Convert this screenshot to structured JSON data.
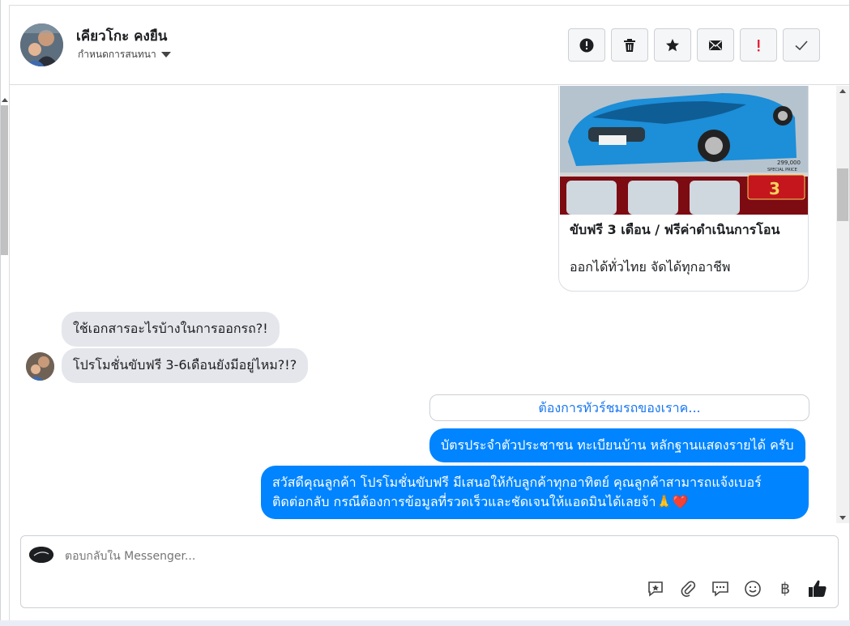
{
  "header": {
    "contact_name": "เคียวโกะ คงยืน",
    "assign_label": "กำหนดการสนทนา",
    "actions": [
      {
        "name": "spam-button",
        "icon": "alert-circle-icon"
      },
      {
        "name": "delete-button",
        "icon": "trash-icon"
      },
      {
        "name": "star-button",
        "icon": "star-icon"
      },
      {
        "name": "mark-unread-button",
        "icon": "envelope-icon"
      },
      {
        "name": "follow-up-button",
        "icon": "exclamation-icon"
      },
      {
        "name": "done-button",
        "icon": "check-icon"
      }
    ]
  },
  "card": {
    "image_caption_price": "299,000",
    "image_caption_tag": "SPECIAL PRICE",
    "image_badge_number": "3",
    "title": "ขับฟรี 3 เดือน / ฟรีค่าดำเนินการโอน",
    "subtitle": "ออกได้ทั่วไทย จัดได้ทุกอาชีพ"
  },
  "messages": {
    "in_1": "ใช้เอกสารอะไรบ้างในการออกรถ?!",
    "in_2": "โปรโมชั่นขับฟรี 3-6เดือนยังมีอยู่ไหม?!?",
    "quick_reply": "ต้องการทัวร์ชมรถของเราค...",
    "out_1": "บัตรประจำตัวประชาชน ทะเบียนบ้าน หลักฐานแสดงรายได้ ครับ",
    "out_2_line1": "สวัสดีคุณลูกค้า โปรโมชั่นขับฟรี มีเสนอให้กับลูกค้าทุกอาทิตย์ คุณลูกค้าสามารถแจ้งเบอร์",
    "out_2_line2": "ติดต่อกลับ กรณีต้องการข้อมูลที่รวดเร็วและชัดเจนให้แอดมินได้เลยจ้า🙏❤️"
  },
  "composer": {
    "placeholder": "ตอบกลับใน Messenger...",
    "tools": [
      "saved-reply-icon",
      "attachment-icon",
      "chat-bubbles-icon",
      "emoji-icon",
      "baht-icon",
      "like-icon"
    ],
    "baht_symbol": "฿"
  },
  "colors": {
    "accent": "#0084ff",
    "link": "#1877f2",
    "bubble_in": "#e4e6eb",
    "follow_up_red": "#e4263a"
  }
}
